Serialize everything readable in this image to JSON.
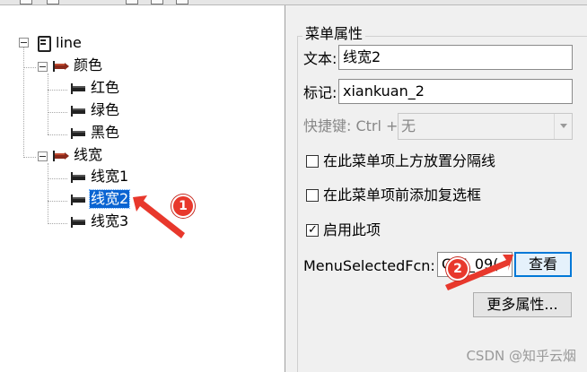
{
  "tree": {
    "root": "line",
    "nodes": [
      {
        "label": "颜色",
        "children": [
          "红色",
          "绿色",
          "黑色"
        ]
      },
      {
        "label": "线宽",
        "children": [
          "线宽1",
          "线宽2",
          "线宽3"
        ]
      }
    ],
    "selected": "线宽2"
  },
  "annotations": {
    "marker1": "1",
    "marker2": "2"
  },
  "properties": {
    "group_title": "菜单属性",
    "text_label": "文本:",
    "text_value": "线宽2",
    "tag_label": "标记:",
    "tag_value": "xiankuan_2",
    "shortcut_label": "快捷键: Ctrl +",
    "shortcut_value": "无",
    "separator_check": "在此菜单项上方放置分隔线",
    "checkbox_check": "在此菜单项前添加复选框",
    "enable_check": "启用此项",
    "separator_checked": false,
    "checkbox_checked": false,
    "enable_checked": true,
    "fcn_label": "MenuSelectedFcn:",
    "fcn_value": "GUI_09(",
    "view_button": "查看",
    "more_button": "更多属性..."
  },
  "watermark": "CSDN @知乎云烟",
  "colors": {
    "selection": "#0a64d2",
    "annotation": "#e8382c"
  }
}
